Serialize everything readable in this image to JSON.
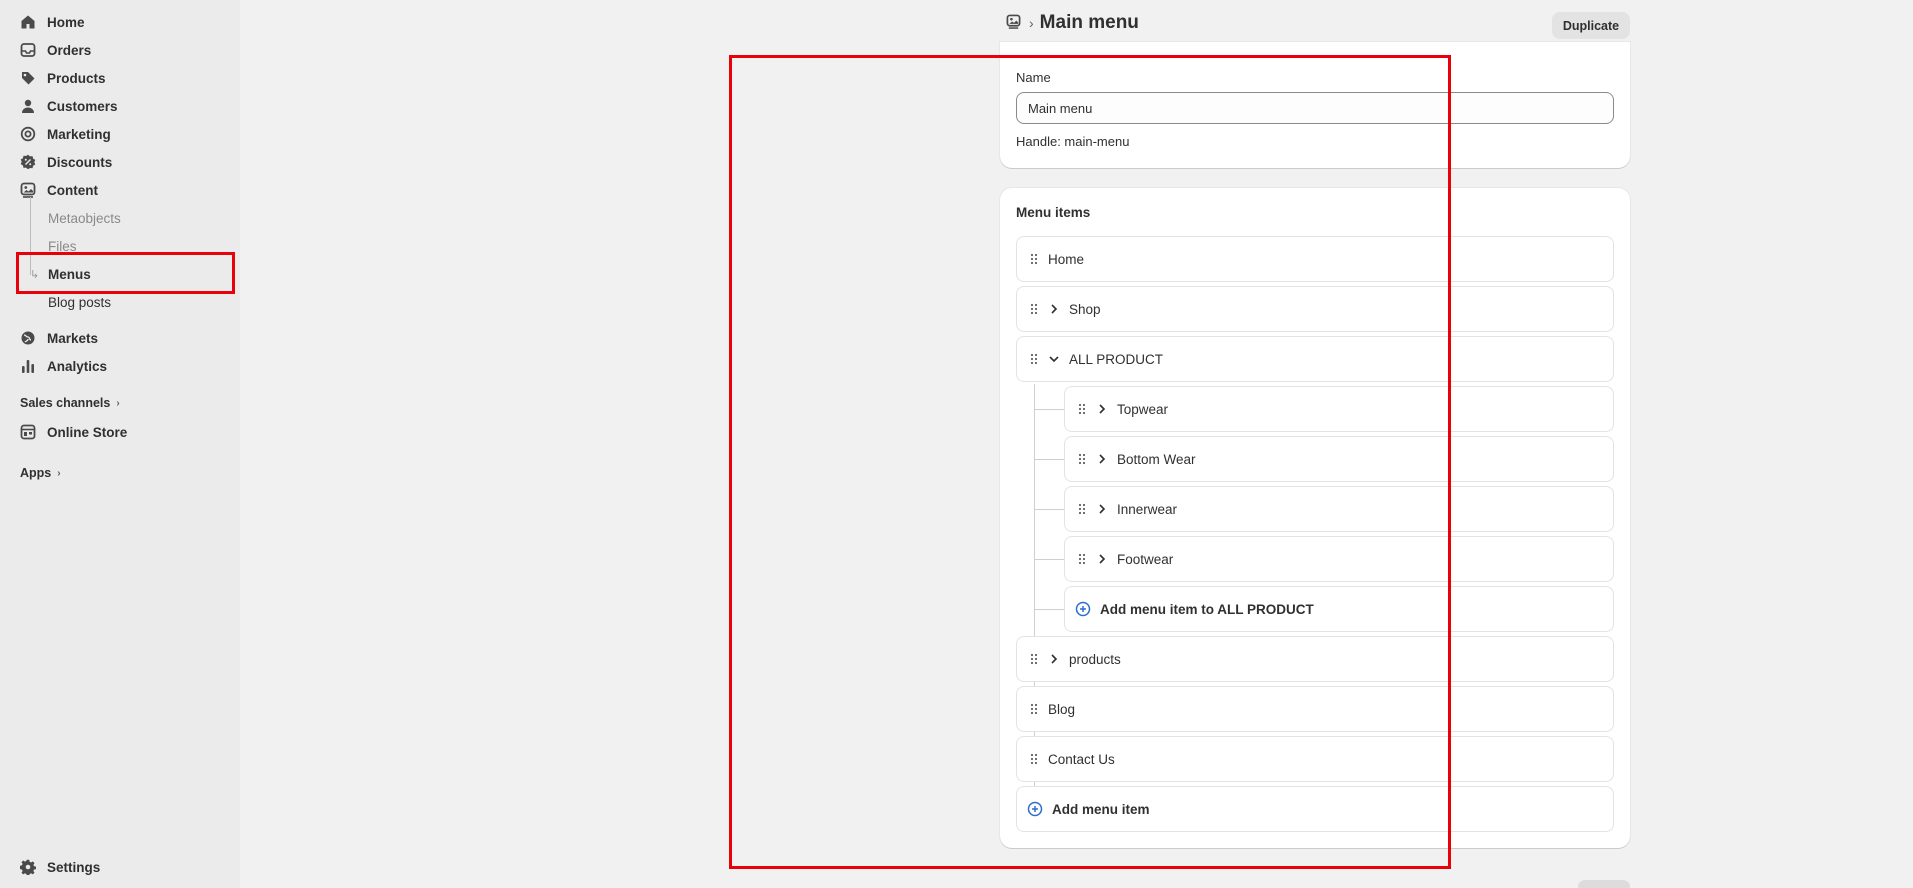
{
  "sidebar": {
    "nav": [
      {
        "label": "Home",
        "icon": "home-icon"
      },
      {
        "label": "Orders",
        "icon": "inbox-icon"
      },
      {
        "label": "Products",
        "icon": "tag-icon"
      },
      {
        "label": "Customers",
        "icon": "person-icon"
      },
      {
        "label": "Marketing",
        "icon": "target-icon"
      },
      {
        "label": "Discounts",
        "icon": "discount-icon"
      },
      {
        "label": "Content",
        "icon": "content-icon"
      }
    ],
    "content_sub": [
      "Metaobjects",
      "Files",
      "Menus",
      "Blog posts"
    ],
    "nav2": [
      {
        "label": "Markets",
        "icon": "globe-icon"
      },
      {
        "label": "Analytics",
        "icon": "bar-chart-icon"
      }
    ],
    "sales_channels": "Sales channels",
    "online_store": "Online Store",
    "apps": "Apps",
    "settings": "Settings",
    "active_item": "Menus"
  },
  "header": {
    "title": "Main menu",
    "duplicate_label": "Duplicate"
  },
  "name_card": {
    "label": "Name",
    "value": "Main menu",
    "handle": "Handle: main-menu"
  },
  "menu_card": {
    "heading": "Menu items",
    "items": [
      {
        "label": "Home"
      },
      {
        "label": "Shop",
        "expandable": true,
        "expanded": false
      },
      {
        "label": "ALL PRODUCT",
        "expandable": true,
        "expanded": true,
        "children": [
          {
            "label": "Topwear"
          },
          {
            "label": "Bottom Wear"
          },
          {
            "label": "Innerwear"
          },
          {
            "label": "Footwear"
          }
        ],
        "add_child_label": "Add menu item to ALL PRODUCT"
      },
      {
        "label": "products",
        "expandable": true,
        "expanded": false
      },
      {
        "label": "Blog"
      },
      {
        "label": "Contact Us"
      }
    ],
    "add_label": "Add menu item"
  },
  "colors": {
    "sidebar_bg": "#ebebeb",
    "page_bg": "#f1f1f1",
    "accent_blue": "#2c6ecb",
    "annotation_red": "#e8000b"
  }
}
